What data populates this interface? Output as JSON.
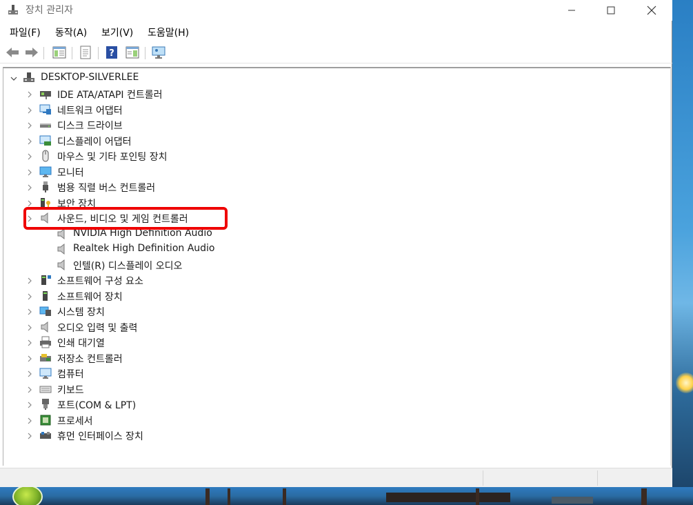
{
  "window": {
    "title": "장치 관리자"
  },
  "menu": [
    "파일(F)",
    "동작(A)",
    "보기(V)",
    "도움말(H)"
  ],
  "tree": {
    "root": "DESKTOP-SILVERLEE",
    "categories": [
      {
        "label": "IDE ATA/ATAPI 컨트롤러",
        "icon": "ide-controller-icon"
      },
      {
        "label": "네트워크 어댑터",
        "icon": "network-adapter-icon"
      },
      {
        "label": "디스크 드라이브",
        "icon": "disk-drive-icon"
      },
      {
        "label": "디스플레이 어댑터",
        "icon": "display-adapter-icon"
      },
      {
        "label": "마우스 및 기타 포인팅 장치",
        "icon": "mouse-icon"
      },
      {
        "label": "모니터",
        "icon": "monitor-icon"
      },
      {
        "label": "범용 직렬 버스 컨트롤러",
        "icon": "usb-icon"
      },
      {
        "label": "보안 장치",
        "icon": "security-device-icon"
      },
      {
        "label": "사운드, 비디오 및 게임 컨트롤러",
        "icon": "speaker-icon"
      },
      {
        "label": "소프트웨어 구성 요소",
        "icon": "software-component-icon"
      },
      {
        "label": "소프트웨어 장치",
        "icon": "software-device-icon"
      },
      {
        "label": "시스템 장치",
        "icon": "system-device-icon"
      },
      {
        "label": "오디오 입력 및 출력",
        "icon": "speaker-icon"
      },
      {
        "label": "인쇄 대기열",
        "icon": "printer-icon"
      },
      {
        "label": "저장소 컨트롤러",
        "icon": "storage-controller-icon"
      },
      {
        "label": "컴퓨터",
        "icon": "computer-icon"
      },
      {
        "label": "키보드",
        "icon": "keyboard-icon"
      },
      {
        "label": "포트(COM & LPT)",
        "icon": "port-icon"
      },
      {
        "label": "프로세서",
        "icon": "processor-icon"
      },
      {
        "label": "휴먼 인터페이스 장치",
        "icon": "hid-icon"
      }
    ],
    "sound_children": [
      "NVIDIA High Definition Audio",
      "Realtek High Definition Audio",
      "인텔(R) 디스플레이 오디오"
    ]
  },
  "colors": {
    "highlight": "#ef0000",
    "accent": "#2a8ad8"
  }
}
